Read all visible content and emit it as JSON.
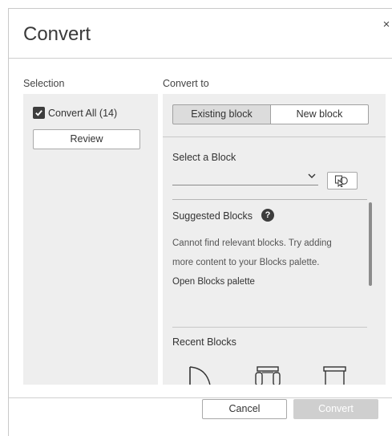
{
  "dialog": {
    "title": "Convert",
    "close_glyph": "×"
  },
  "selection": {
    "label": "Selection",
    "convert_all_label": "Convert All (14)",
    "convert_all_checked": true,
    "review_label": "Review"
  },
  "convert_to": {
    "label": "Convert to",
    "tabs": [
      {
        "label": "Existing block",
        "selected": true
      },
      {
        "label": "New block",
        "selected": false
      }
    ],
    "select_block_label": "Select a Block",
    "select_block_value": "",
    "suggested_label": "Suggested Blocks",
    "suggested_message_line1": "Cannot find relevant blocks. Try adding",
    "suggested_message_line2": "more content to your Blocks palette.",
    "open_palette_link": "Open Blocks palette",
    "recent_label": "Recent Blocks",
    "recent_blocks": [
      "door-block-icon",
      "chair-block-icon",
      "desk-block-icon"
    ]
  },
  "footer": {
    "cancel_label": "Cancel",
    "convert_label": "Convert",
    "convert_enabled": false
  },
  "colors": {
    "panel_bg": "#eeeeee",
    "selected_tab_bg": "#dcdcdc",
    "checkbox": "#3d3d3d",
    "disabled_button": "#cfcfcf"
  }
}
